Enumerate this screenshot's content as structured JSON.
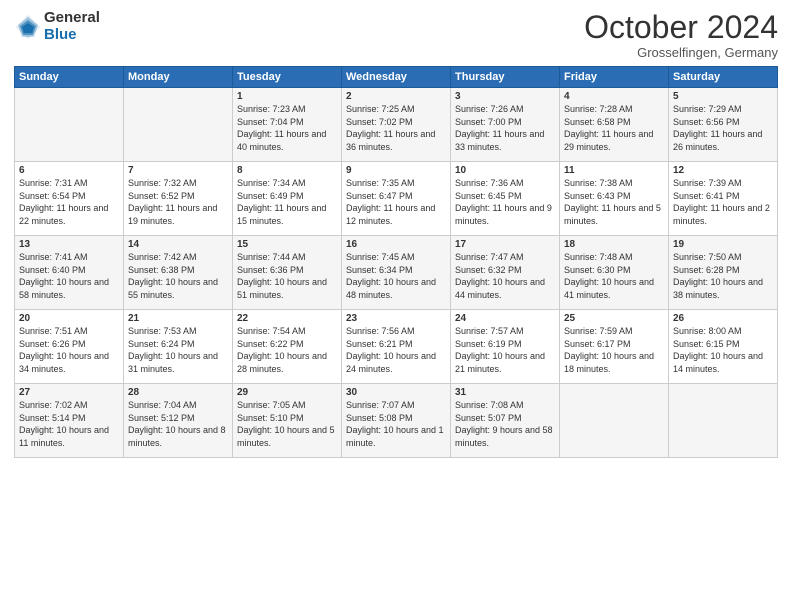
{
  "header": {
    "logo_general": "General",
    "logo_blue": "Blue",
    "month_title": "October 2024",
    "location": "Grosselfingen, Germany"
  },
  "days_of_week": [
    "Sunday",
    "Monday",
    "Tuesday",
    "Wednesday",
    "Thursday",
    "Friday",
    "Saturday"
  ],
  "weeks": [
    [
      {
        "day": "",
        "sunrise": "",
        "sunset": "",
        "daylight": ""
      },
      {
        "day": "",
        "sunrise": "",
        "sunset": "",
        "daylight": ""
      },
      {
        "day": "1",
        "sunrise": "Sunrise: 7:23 AM",
        "sunset": "Sunset: 7:04 PM",
        "daylight": "Daylight: 11 hours and 40 minutes."
      },
      {
        "day": "2",
        "sunrise": "Sunrise: 7:25 AM",
        "sunset": "Sunset: 7:02 PM",
        "daylight": "Daylight: 11 hours and 36 minutes."
      },
      {
        "day": "3",
        "sunrise": "Sunrise: 7:26 AM",
        "sunset": "Sunset: 7:00 PM",
        "daylight": "Daylight: 11 hours and 33 minutes."
      },
      {
        "day": "4",
        "sunrise": "Sunrise: 7:28 AM",
        "sunset": "Sunset: 6:58 PM",
        "daylight": "Daylight: 11 hours and 29 minutes."
      },
      {
        "day": "5",
        "sunrise": "Sunrise: 7:29 AM",
        "sunset": "Sunset: 6:56 PM",
        "daylight": "Daylight: 11 hours and 26 minutes."
      }
    ],
    [
      {
        "day": "6",
        "sunrise": "Sunrise: 7:31 AM",
        "sunset": "Sunset: 6:54 PM",
        "daylight": "Daylight: 11 hours and 22 minutes."
      },
      {
        "day": "7",
        "sunrise": "Sunrise: 7:32 AM",
        "sunset": "Sunset: 6:52 PM",
        "daylight": "Daylight: 11 hours and 19 minutes."
      },
      {
        "day": "8",
        "sunrise": "Sunrise: 7:34 AM",
        "sunset": "Sunset: 6:49 PM",
        "daylight": "Daylight: 11 hours and 15 minutes."
      },
      {
        "day": "9",
        "sunrise": "Sunrise: 7:35 AM",
        "sunset": "Sunset: 6:47 PM",
        "daylight": "Daylight: 11 hours and 12 minutes."
      },
      {
        "day": "10",
        "sunrise": "Sunrise: 7:36 AM",
        "sunset": "Sunset: 6:45 PM",
        "daylight": "Daylight: 11 hours and 9 minutes."
      },
      {
        "day": "11",
        "sunrise": "Sunrise: 7:38 AM",
        "sunset": "Sunset: 6:43 PM",
        "daylight": "Daylight: 11 hours and 5 minutes."
      },
      {
        "day": "12",
        "sunrise": "Sunrise: 7:39 AM",
        "sunset": "Sunset: 6:41 PM",
        "daylight": "Daylight: 11 hours and 2 minutes."
      }
    ],
    [
      {
        "day": "13",
        "sunrise": "Sunrise: 7:41 AM",
        "sunset": "Sunset: 6:40 PM",
        "daylight": "Daylight: 10 hours and 58 minutes."
      },
      {
        "day": "14",
        "sunrise": "Sunrise: 7:42 AM",
        "sunset": "Sunset: 6:38 PM",
        "daylight": "Daylight: 10 hours and 55 minutes."
      },
      {
        "day": "15",
        "sunrise": "Sunrise: 7:44 AM",
        "sunset": "Sunset: 6:36 PM",
        "daylight": "Daylight: 10 hours and 51 minutes."
      },
      {
        "day": "16",
        "sunrise": "Sunrise: 7:45 AM",
        "sunset": "Sunset: 6:34 PM",
        "daylight": "Daylight: 10 hours and 48 minutes."
      },
      {
        "day": "17",
        "sunrise": "Sunrise: 7:47 AM",
        "sunset": "Sunset: 6:32 PM",
        "daylight": "Daylight: 10 hours and 44 minutes."
      },
      {
        "day": "18",
        "sunrise": "Sunrise: 7:48 AM",
        "sunset": "Sunset: 6:30 PM",
        "daylight": "Daylight: 10 hours and 41 minutes."
      },
      {
        "day": "19",
        "sunrise": "Sunrise: 7:50 AM",
        "sunset": "Sunset: 6:28 PM",
        "daylight": "Daylight: 10 hours and 38 minutes."
      }
    ],
    [
      {
        "day": "20",
        "sunrise": "Sunrise: 7:51 AM",
        "sunset": "Sunset: 6:26 PM",
        "daylight": "Daylight: 10 hours and 34 minutes."
      },
      {
        "day": "21",
        "sunrise": "Sunrise: 7:53 AM",
        "sunset": "Sunset: 6:24 PM",
        "daylight": "Daylight: 10 hours and 31 minutes."
      },
      {
        "day": "22",
        "sunrise": "Sunrise: 7:54 AM",
        "sunset": "Sunset: 6:22 PM",
        "daylight": "Daylight: 10 hours and 28 minutes."
      },
      {
        "day": "23",
        "sunrise": "Sunrise: 7:56 AM",
        "sunset": "Sunset: 6:21 PM",
        "daylight": "Daylight: 10 hours and 24 minutes."
      },
      {
        "day": "24",
        "sunrise": "Sunrise: 7:57 AM",
        "sunset": "Sunset: 6:19 PM",
        "daylight": "Daylight: 10 hours and 21 minutes."
      },
      {
        "day": "25",
        "sunrise": "Sunrise: 7:59 AM",
        "sunset": "Sunset: 6:17 PM",
        "daylight": "Daylight: 10 hours and 18 minutes."
      },
      {
        "day": "26",
        "sunrise": "Sunrise: 8:00 AM",
        "sunset": "Sunset: 6:15 PM",
        "daylight": "Daylight: 10 hours and 14 minutes."
      }
    ],
    [
      {
        "day": "27",
        "sunrise": "Sunrise: 7:02 AM",
        "sunset": "Sunset: 5:14 PM",
        "daylight": "Daylight: 10 hours and 11 minutes."
      },
      {
        "day": "28",
        "sunrise": "Sunrise: 7:04 AM",
        "sunset": "Sunset: 5:12 PM",
        "daylight": "Daylight: 10 hours and 8 minutes."
      },
      {
        "day": "29",
        "sunrise": "Sunrise: 7:05 AM",
        "sunset": "Sunset: 5:10 PM",
        "daylight": "Daylight: 10 hours and 5 minutes."
      },
      {
        "day": "30",
        "sunrise": "Sunrise: 7:07 AM",
        "sunset": "Sunset: 5:08 PM",
        "daylight": "Daylight: 10 hours and 1 minute."
      },
      {
        "day": "31",
        "sunrise": "Sunrise: 7:08 AM",
        "sunset": "Sunset: 5:07 PM",
        "daylight": "Daylight: 9 hours and 58 minutes."
      },
      {
        "day": "",
        "sunrise": "",
        "sunset": "",
        "daylight": ""
      },
      {
        "day": "",
        "sunrise": "",
        "sunset": "",
        "daylight": ""
      }
    ]
  ]
}
